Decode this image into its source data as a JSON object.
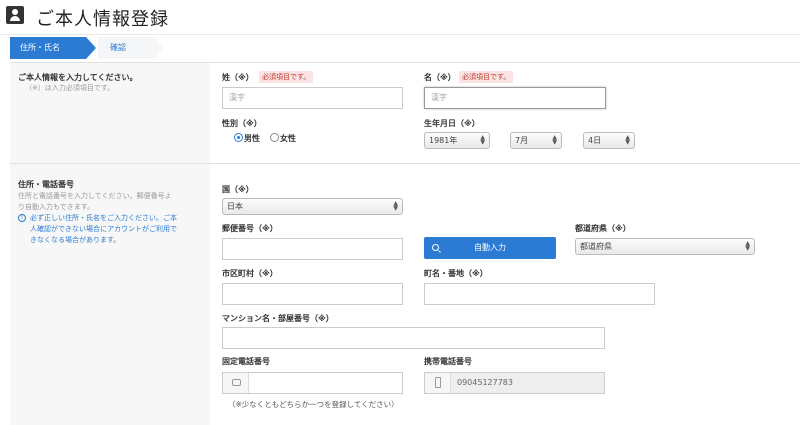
{
  "page": {
    "title": "ご本人情報登録"
  },
  "steps": [
    {
      "label": "住所・氏名"
    },
    {
      "label": "確認"
    }
  ],
  "section1": {
    "heading": "ご本人情報を入力してください。",
    "note": "（※）は入力必須項目です。",
    "last_name": {
      "label": "姓（※）",
      "badge": "必須項目です。",
      "placeholder": "漢字"
    },
    "first_name": {
      "label": "名（※）",
      "badge": "必須項目です。",
      "placeholder": "漢字"
    },
    "gender": {
      "label": "性別（※）",
      "options": [
        "男性",
        "女性"
      ],
      "selected": "男性"
    },
    "birth": {
      "label": "生年月日（※）",
      "year": "1981年",
      "month": "7月",
      "day": "4日"
    }
  },
  "section2": {
    "heading": "住所・電話番号",
    "note_line1": "住所と電話番号を入力してください。郵便番号よ",
    "note_line2": "り自動入力もできます。",
    "warn_line1": "必ず正しい住所・氏名をご入力ください。ご本",
    "warn_line2": "人確認ができない場合にアカウントがご利用で",
    "warn_line3": "きなくなる場合があります。",
    "country": {
      "label": "国（※）",
      "value": "日本"
    },
    "postal": {
      "label": "郵便番号（※）",
      "button": "自動入力"
    },
    "prefecture": {
      "label": "都道府県（※）",
      "value": "都道府県"
    },
    "city": {
      "label": "市区町村（※）"
    },
    "street": {
      "label": "町名・番地（※）"
    },
    "building": {
      "label": "マンション名・部屋番号（※）"
    },
    "landline": {
      "label": "固定電話番号"
    },
    "mobile": {
      "label": "携帯電話番号",
      "value": "09045127783"
    },
    "phone_hint": "（※少なくともどちらか一つを登録してください）"
  },
  "colors": {
    "accent": "#2b7bd4",
    "required_bg": "#fbe3e3",
    "required_text": "#c0392b"
  }
}
